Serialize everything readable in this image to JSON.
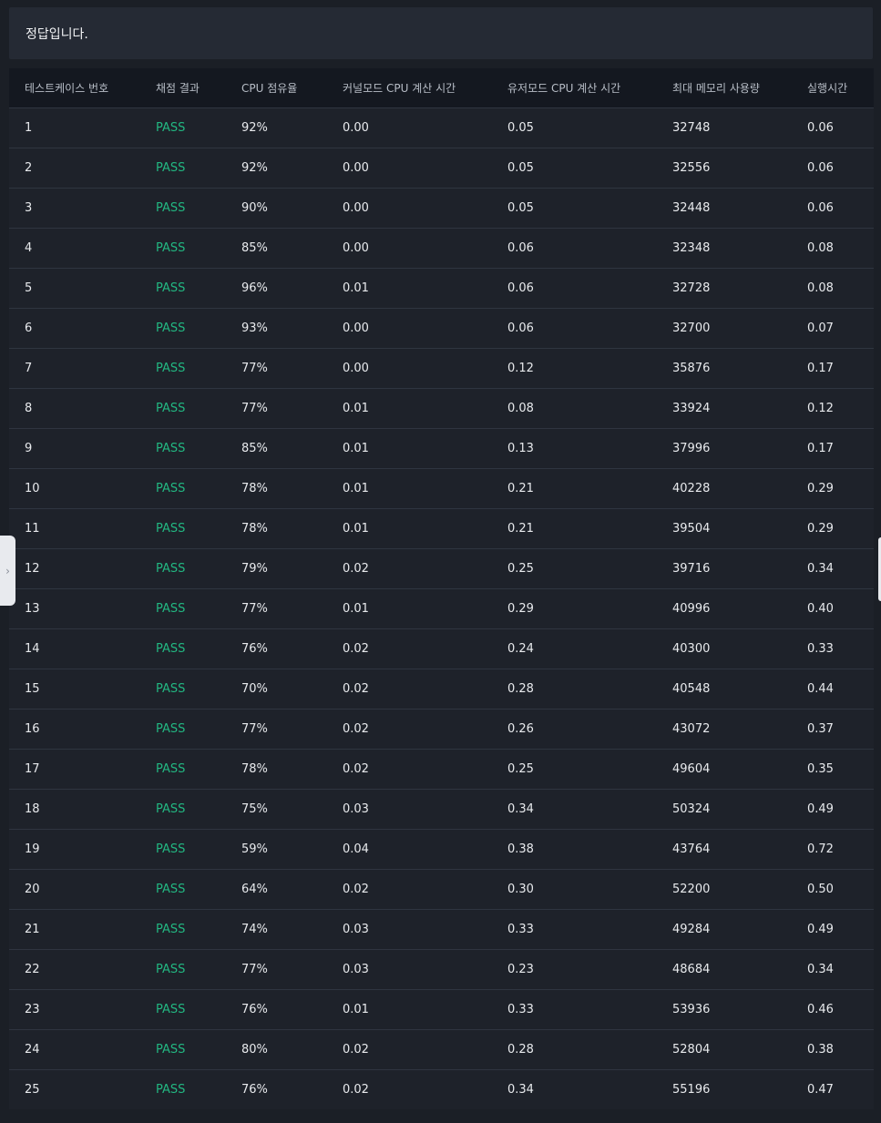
{
  "banner": {
    "message": "정답입니다."
  },
  "table": {
    "columns": [
      "테스트케이스 번호",
      "채점 결과",
      "CPU 점유율",
      "커널모드 CPU 계산 시간",
      "유저모드 CPU 계산 시간",
      "최대 메모리 사용량",
      "실행시간"
    ],
    "rows": [
      [
        "1",
        "PASS",
        "92%",
        "0.00",
        "0.05",
        "32748",
        "0.06"
      ],
      [
        "2",
        "PASS",
        "92%",
        "0.00",
        "0.05",
        "32556",
        "0.06"
      ],
      [
        "3",
        "PASS",
        "90%",
        "0.00",
        "0.05",
        "32448",
        "0.06"
      ],
      [
        "4",
        "PASS",
        "85%",
        "0.00",
        "0.06",
        "32348",
        "0.08"
      ],
      [
        "5",
        "PASS",
        "96%",
        "0.01",
        "0.06",
        "32728",
        "0.08"
      ],
      [
        "6",
        "PASS",
        "93%",
        "0.00",
        "0.06",
        "32700",
        "0.07"
      ],
      [
        "7",
        "PASS",
        "77%",
        "0.00",
        "0.12",
        "35876",
        "0.17"
      ],
      [
        "8",
        "PASS",
        "77%",
        "0.01",
        "0.08",
        "33924",
        "0.12"
      ],
      [
        "9",
        "PASS",
        "85%",
        "0.01",
        "0.13",
        "37996",
        "0.17"
      ],
      [
        "10",
        "PASS",
        "78%",
        "0.01",
        "0.21",
        "40228",
        "0.29"
      ],
      [
        "11",
        "PASS",
        "78%",
        "0.01",
        "0.21",
        "39504",
        "0.29"
      ],
      [
        "12",
        "PASS",
        "79%",
        "0.02",
        "0.25",
        "39716",
        "0.34"
      ],
      [
        "13",
        "PASS",
        "77%",
        "0.01",
        "0.29",
        "40996",
        "0.40"
      ],
      [
        "14",
        "PASS",
        "76%",
        "0.02",
        "0.24",
        "40300",
        "0.33"
      ],
      [
        "15",
        "PASS",
        "70%",
        "0.02",
        "0.28",
        "40548",
        "0.44"
      ],
      [
        "16",
        "PASS",
        "77%",
        "0.02",
        "0.26",
        "43072",
        "0.37"
      ],
      [
        "17",
        "PASS",
        "78%",
        "0.02",
        "0.25",
        "49604",
        "0.35"
      ],
      [
        "18",
        "PASS",
        "75%",
        "0.03",
        "0.34",
        "50324",
        "0.49"
      ],
      [
        "19",
        "PASS",
        "59%",
        "0.04",
        "0.38",
        "43764",
        "0.72"
      ],
      [
        "20",
        "PASS",
        "64%",
        "0.02",
        "0.30",
        "52200",
        "0.50"
      ],
      [
        "21",
        "PASS",
        "74%",
        "0.03",
        "0.33",
        "49284",
        "0.49"
      ],
      [
        "22",
        "PASS",
        "77%",
        "0.03",
        "0.23",
        "48684",
        "0.34"
      ],
      [
        "23",
        "PASS",
        "76%",
        "0.01",
        "0.33",
        "53936",
        "0.46"
      ],
      [
        "24",
        "PASS",
        "80%",
        "0.02",
        "0.28",
        "52804",
        "0.38"
      ],
      [
        "25",
        "PASS",
        "76%",
        "0.02",
        "0.34",
        "55196",
        "0.47"
      ]
    ]
  },
  "side_panel": {
    "toggle_icon": "chevron-right-icon",
    "toggle_glyph": "›"
  },
  "colors": {
    "pass": "#22b882",
    "background": "#1b1f26",
    "header": "#141820",
    "banner": "#252a34"
  }
}
